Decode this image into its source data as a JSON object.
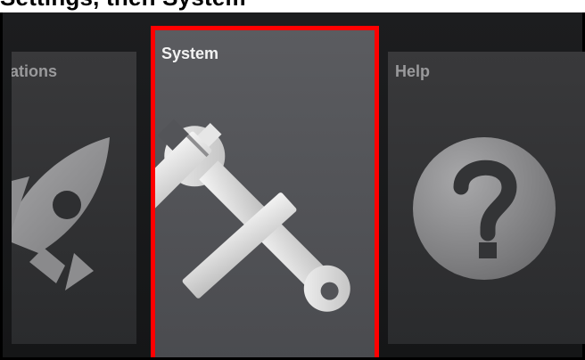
{
  "caption": {
    "text": "Settings, then System"
  },
  "tiles": {
    "left": {
      "label": "cations",
      "icon": "rocket-icon"
    },
    "center": {
      "label": "System",
      "icon": "tools-icon",
      "selected": true
    },
    "right": {
      "label": "Help",
      "icon": "help-circle-icon"
    }
  },
  "colors": {
    "highlight": "#ff0000",
    "background": "#1c1d1f",
    "tile": "#333436",
    "tile_selected": "#55565a"
  }
}
